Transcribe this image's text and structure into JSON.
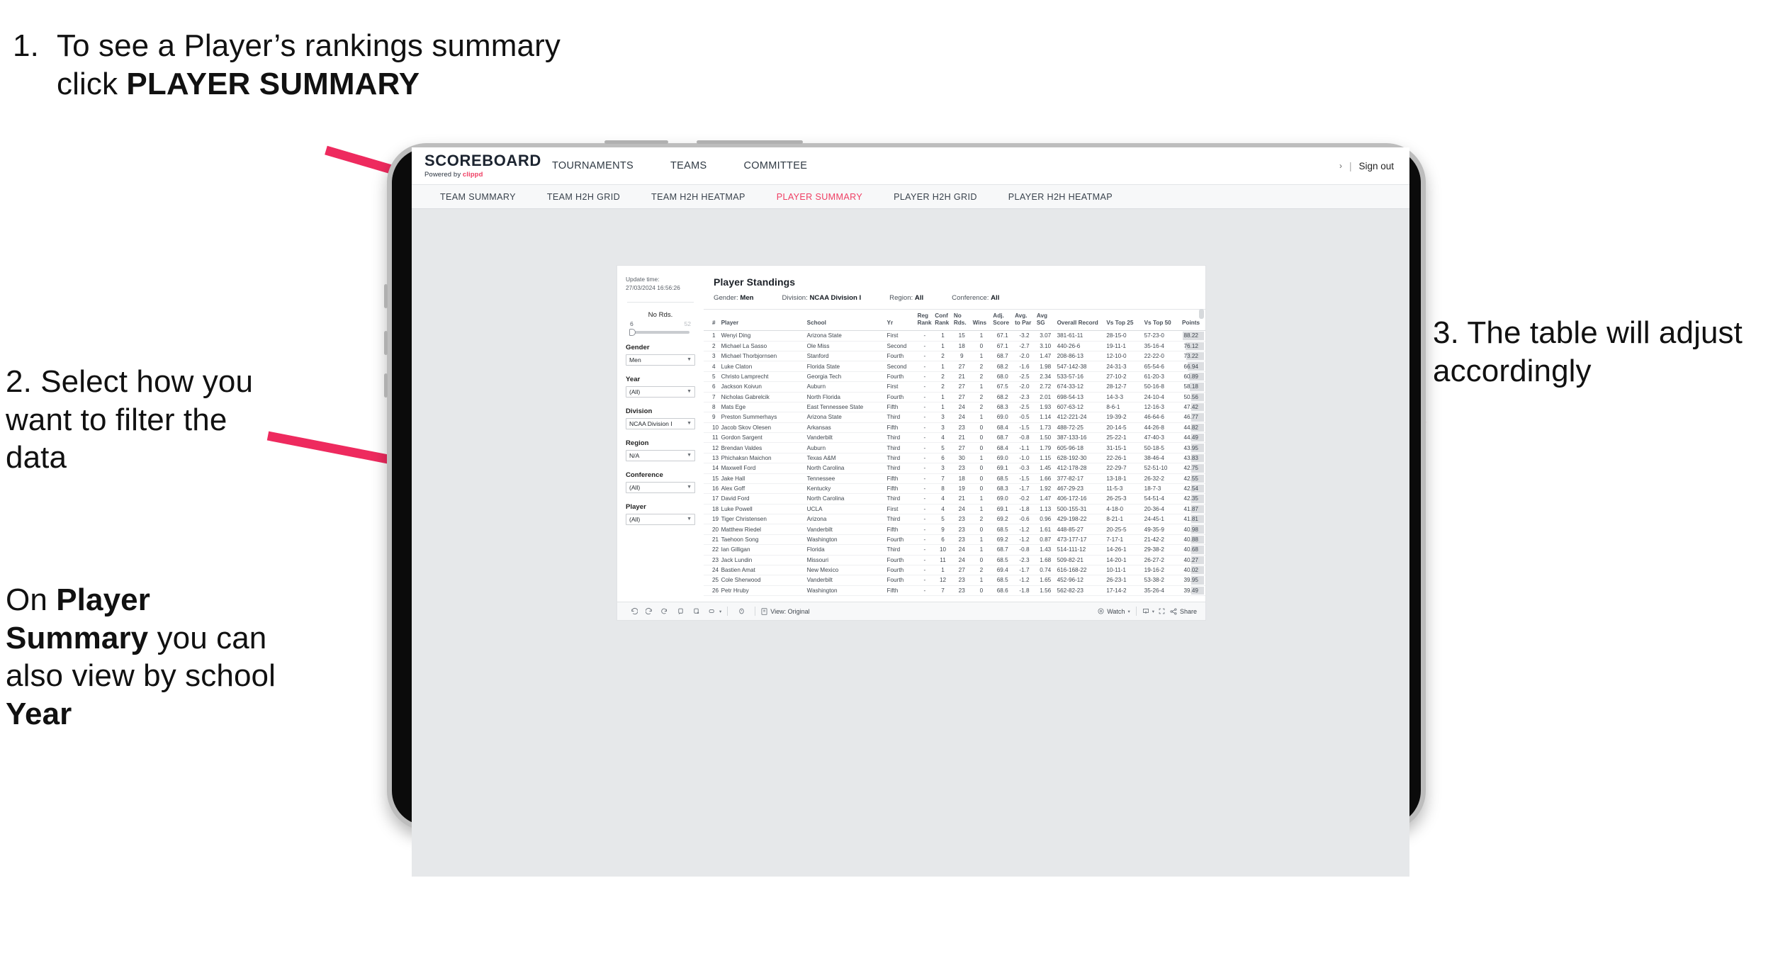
{
  "annotations": {
    "step1": {
      "number": "1.",
      "text_before": "To see a Player’s rankings summary click ",
      "bold": "PLAYER SUMMARY"
    },
    "step2": {
      "line": "2. Select how you want to filter the data"
    },
    "step2b": {
      "pre": "On ",
      "b1": "Player Summary",
      "mid": " you can also view by school ",
      "b2": "Year"
    },
    "step3": {
      "line": "3. The table will adjust accordingly"
    },
    "arrow_color": "#ee2a5e"
  },
  "app": {
    "brand": {
      "logo": "SCOREBOARD",
      "powered_prefix": "Powered by ",
      "powered_brand": "clippd"
    },
    "top_nav": [
      "TOURNAMENTS",
      "TEAMS",
      "COMMITTEE"
    ],
    "header_right": {
      "chevron": "›",
      "separator": "|",
      "sign_out": "Sign out"
    },
    "sub_tabs": [
      {
        "label": "TEAM SUMMARY",
        "active": false
      },
      {
        "label": "TEAM H2H GRID",
        "active": false
      },
      {
        "label": "TEAM H2H HEATMAP",
        "active": false
      },
      {
        "label": "PLAYER SUMMARY",
        "active": true
      },
      {
        "label": "PLAYER H2H GRID",
        "active": false
      },
      {
        "label": "PLAYER H2H HEATMAP",
        "active": false
      }
    ],
    "accent_color": "#ef3e63"
  },
  "filters": {
    "update_label": "Update time:",
    "update_value": "27/03/2024 16:56:26",
    "slider": {
      "title": "No Rds.",
      "min": "6",
      "max": "52",
      "value_pct": 8
    },
    "controls": [
      {
        "label": "Gender",
        "value": "Men"
      },
      {
        "label": "Year",
        "value": "(All)"
      },
      {
        "label": "Division",
        "value": "NCAA Division I"
      },
      {
        "label": "Region",
        "value": "N/A"
      },
      {
        "label": "Conference",
        "value": "(All)"
      },
      {
        "label": "Player",
        "value": "(All)"
      }
    ]
  },
  "sheet": {
    "title": "Player Standings",
    "summary": [
      {
        "label": "Gender:",
        "value": "Men"
      },
      {
        "label": "Division:",
        "value": "NCAA Division I"
      },
      {
        "label": "Region:",
        "value": "All"
      },
      {
        "label": "Conference:",
        "value": "All"
      }
    ]
  },
  "table": {
    "columns": [
      "#",
      "Player",
      "School",
      "Yr",
      "Reg Rank",
      "Conf Rank",
      "No Rds.",
      "Wins",
      "Adj. Score",
      "Avg. to Par",
      "Avg SG",
      "Overall Record",
      "Vs Top 25",
      "Vs Top 50",
      "Points"
    ],
    "rows": [
      [
        "1",
        "Wenyi Ding",
        "Arizona State",
        "First",
        "-",
        "1",
        "15",
        "1",
        "67.1",
        "-3.2",
        "3.07",
        "381-61-11",
        "28-15-0",
        "57-23-0",
        "88.22"
      ],
      [
        "2",
        "Michael La Sasso",
        "Ole Miss",
        "Second",
        "-",
        "1",
        "18",
        "0",
        "67.1",
        "-2.7",
        "3.10",
        "440-26-6",
        "19-11-1",
        "35-16-4",
        "76.12"
      ],
      [
        "3",
        "Michael Thorbjornsen",
        "Stanford",
        "Fourth",
        "-",
        "2",
        "9",
        "1",
        "68.7",
        "-2.0",
        "1.47",
        "208-86-13",
        "12-10-0",
        "22-22-0",
        "73.22"
      ],
      [
        "4",
        "Luke Claton",
        "Florida State",
        "Second",
        "-",
        "1",
        "27",
        "2",
        "68.2",
        "-1.6",
        "1.98",
        "547-142-38",
        "24-31-3",
        "65-54-6",
        "66.94"
      ],
      [
        "5",
        "Christo Lamprecht",
        "Georgia Tech",
        "Fourth",
        "-",
        "2",
        "21",
        "2",
        "68.0",
        "-2.5",
        "2.34",
        "533-57-16",
        "27-10-2",
        "61-20-3",
        "60.89"
      ],
      [
        "6",
        "Jackson Koivun",
        "Auburn",
        "First",
        "-",
        "2",
        "27",
        "1",
        "67.5",
        "-2.0",
        "2.72",
        "674-33-12",
        "28-12-7",
        "50-16-8",
        "58.18"
      ],
      [
        "7",
        "Nicholas Gabrelcik",
        "North Florida",
        "Fourth",
        "-",
        "1",
        "27",
        "2",
        "68.2",
        "-2.3",
        "2.01",
        "698-54-13",
        "14-3-3",
        "24-10-4",
        "50.56"
      ],
      [
        "8",
        "Mats Ege",
        "East Tennessee State",
        "Fifth",
        "-",
        "1",
        "24",
        "2",
        "68.3",
        "-2.5",
        "1.93",
        "607-63-12",
        "8-6-1",
        "12-16-3",
        "47.42"
      ],
      [
        "9",
        "Preston Summerhays",
        "Arizona State",
        "Third",
        "-",
        "3",
        "24",
        "1",
        "69.0",
        "-0.5",
        "1.14",
        "412-221-24",
        "19-39-2",
        "46-64-6",
        "46.77"
      ],
      [
        "10",
        "Jacob Skov Olesen",
        "Arkansas",
        "Fifth",
        "-",
        "3",
        "23",
        "0",
        "68.4",
        "-1.5",
        "1.73",
        "488-72-25",
        "20-14-5",
        "44-26-8",
        "44.82"
      ],
      [
        "11",
        "Gordon Sargent",
        "Vanderbilt",
        "Third",
        "-",
        "4",
        "21",
        "0",
        "68.7",
        "-0.8",
        "1.50",
        "387-133-16",
        "25-22-1",
        "47-40-3",
        "44.49"
      ],
      [
        "12",
        "Brendan Valdes",
        "Auburn",
        "Third",
        "-",
        "5",
        "27",
        "0",
        "68.4",
        "-1.1",
        "1.79",
        "605-96-18",
        "31-15-1",
        "50-18-5",
        "43.95"
      ],
      [
        "13",
        "Phichaksn Maichon",
        "Texas A&M",
        "Third",
        "-",
        "6",
        "30",
        "1",
        "69.0",
        "-1.0",
        "1.15",
        "628-192-30",
        "22-26-1",
        "38-46-4",
        "43.83"
      ],
      [
        "14",
        "Maxwell Ford",
        "North Carolina",
        "Third",
        "-",
        "3",
        "23",
        "0",
        "69.1",
        "-0.3",
        "1.45",
        "412-178-28",
        "22-29-7",
        "52-51-10",
        "42.75"
      ],
      [
        "15",
        "Jake Hall",
        "Tennessee",
        "Fifth",
        "-",
        "7",
        "18",
        "0",
        "68.5",
        "-1.5",
        "1.66",
        "377-82-17",
        "13-18-1",
        "26-32-2",
        "42.55"
      ],
      [
        "16",
        "Alex Goff",
        "Kentucky",
        "Fifth",
        "-",
        "8",
        "19",
        "0",
        "68.3",
        "-1.7",
        "1.92",
        "467-29-23",
        "11-5-3",
        "18-7-3",
        "42.54"
      ],
      [
        "17",
        "David Ford",
        "North Carolina",
        "Third",
        "-",
        "4",
        "21",
        "1",
        "69.0",
        "-0.2",
        "1.47",
        "406-172-16",
        "26-25-3",
        "54-51-4",
        "42.35"
      ],
      [
        "18",
        "Luke Powell",
        "UCLA",
        "First",
        "-",
        "4",
        "24",
        "1",
        "69.1",
        "-1.8",
        "1.13",
        "500-155-31",
        "4-18-0",
        "20-36-4",
        "41.87"
      ],
      [
        "19",
        "Tiger Christensen",
        "Arizona",
        "Third",
        "-",
        "5",
        "23",
        "2",
        "69.2",
        "-0.6",
        "0.96",
        "429-198-22",
        "8-21-1",
        "24-45-1",
        "41.81"
      ],
      [
        "20",
        "Matthew Riedel",
        "Vanderbilt",
        "Fifth",
        "-",
        "9",
        "23",
        "0",
        "68.5",
        "-1.2",
        "1.61",
        "448-85-27",
        "20-25-5",
        "49-35-9",
        "40.98"
      ],
      [
        "21",
        "Taehoon Song",
        "Washington",
        "Fourth",
        "-",
        "6",
        "23",
        "1",
        "69.2",
        "-1.2",
        "0.87",
        "473-177-17",
        "7-17-1",
        "21-42-2",
        "40.88"
      ],
      [
        "22",
        "Ian Gilligan",
        "Florida",
        "Third",
        "-",
        "10",
        "24",
        "1",
        "68.7",
        "-0.8",
        "1.43",
        "514-111-12",
        "14-26-1",
        "29-38-2",
        "40.68"
      ],
      [
        "23",
        "Jack Lundin",
        "Missouri",
        "Fourth",
        "-",
        "11",
        "24",
        "0",
        "68.5",
        "-2.3",
        "1.68",
        "509-82-21",
        "14-20-1",
        "26-27-2",
        "40.27"
      ],
      [
        "24",
        "Bastien Amat",
        "New Mexico",
        "Fourth",
        "-",
        "1",
        "27",
        "2",
        "69.4",
        "-1.7",
        "0.74",
        "616-168-22",
        "10-11-1",
        "19-16-2",
        "40.02"
      ],
      [
        "25",
        "Cole Sherwood",
        "Vanderbilt",
        "Fourth",
        "-",
        "12",
        "23",
        "1",
        "68.5",
        "-1.2",
        "1.65",
        "452-96-12",
        "26-23-1",
        "53-38-2",
        "39.95"
      ],
      [
        "26",
        "Petr Hruby",
        "Washington",
        "Fifth",
        "-",
        "7",
        "23",
        "0",
        "68.6",
        "-1.8",
        "1.56",
        "562-82-23",
        "17-14-2",
        "35-26-4",
        "39.49"
      ]
    ]
  },
  "toolbar": {
    "icons": [
      "undo-icon",
      "redo-icon",
      "revert-icon",
      "refresh-icon",
      "pause-icon",
      "highlight-icon"
    ],
    "caret": "▾",
    "pause_icon": "clock-icon",
    "view_label": "View: Original",
    "watch_label": "Watch",
    "share_label": "Share",
    "download_icon": "download-icon",
    "fullscreen_icon": "fullscreen-icon"
  }
}
